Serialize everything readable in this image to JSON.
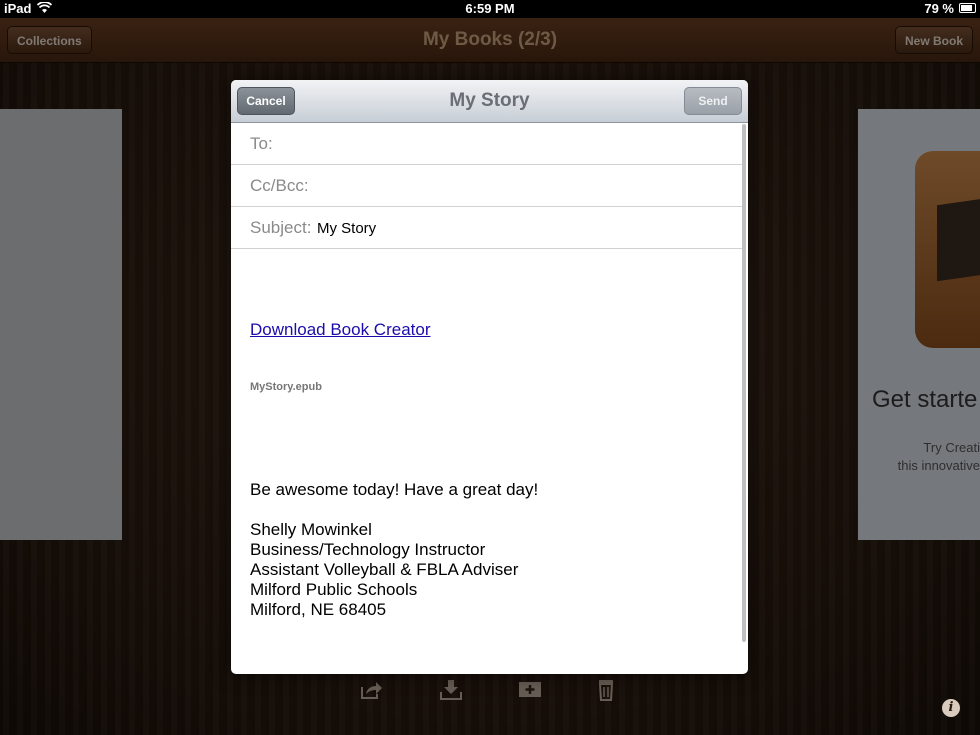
{
  "status_bar": {
    "carrier": "iPad",
    "time": "6:59 PM",
    "battery": "79 %"
  },
  "toolbar": {
    "collections_label": "Collections",
    "title": "My Books (2/3)",
    "new_book_label": "New Book"
  },
  "right_card": {
    "heading": "Get starte",
    "line1": "Try Creati",
    "line2": "this innovative"
  },
  "compose": {
    "cancel_label": "Cancel",
    "title": "My Story",
    "send_label": "Send",
    "to_label": "To:",
    "to_value": "",
    "cc_label": "Cc/Bcc:",
    "cc_value": "",
    "subject_label": "Subject:",
    "subject_value": "My Story",
    "link_text": "Download Book Creator",
    "attachment": "MyStory.epub",
    "message_line": "Be awesome today! Have a great day!",
    "signature": [
      "Shelly Mowinkel",
      "Business/Technology Instructor",
      "Assistant Volleyball & FBLA Adviser",
      "Milford Public Schools",
      "Milford, NE 68405"
    ]
  },
  "bottom_icons": [
    "share-icon",
    "download-icon",
    "add-page-icon",
    "trash-icon",
    "info-icon"
  ],
  "colors": {
    "link": "#1a0dab",
    "wood_toolbar": "#5a331b"
  }
}
